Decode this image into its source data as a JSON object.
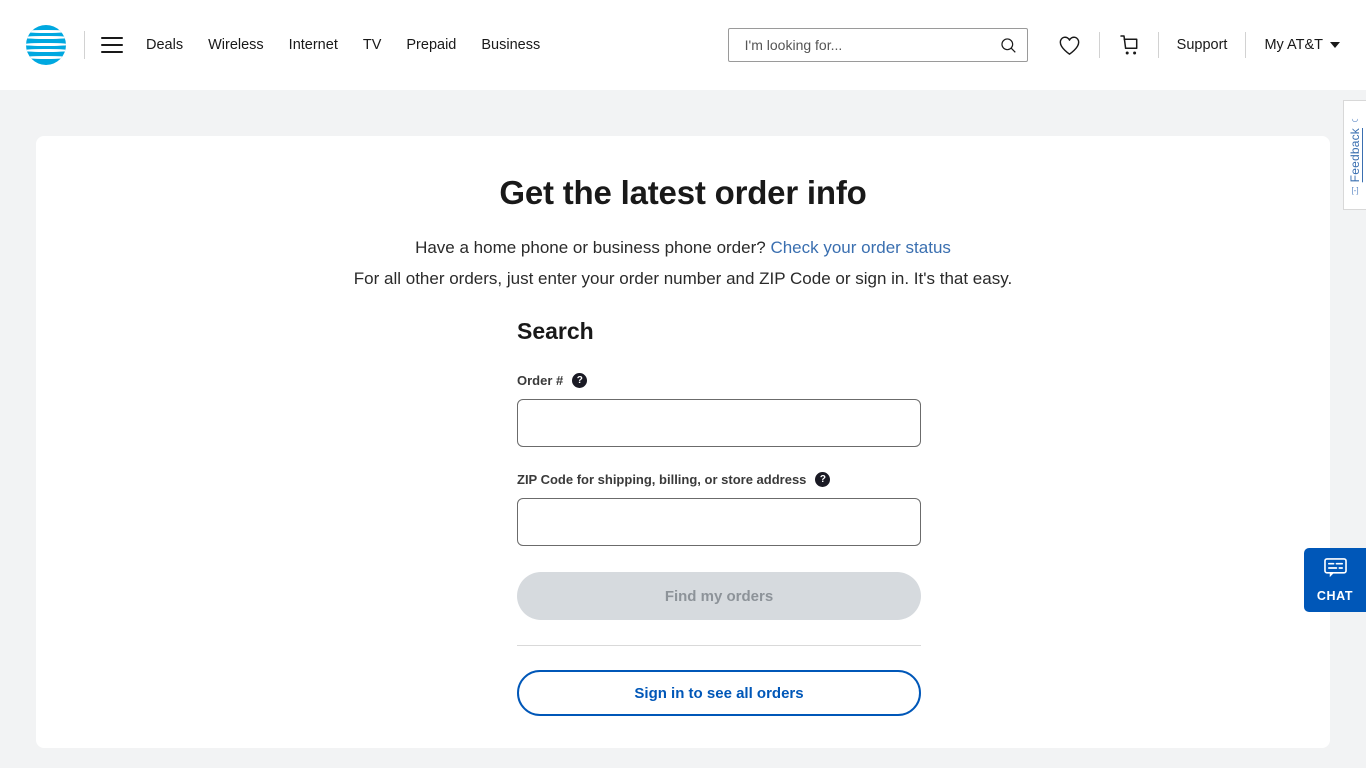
{
  "header": {
    "logo_alt": "AT&T globe logo",
    "menu_label": "Menu",
    "nav": [
      {
        "label": "Deals"
      },
      {
        "label": "Wireless"
      },
      {
        "label": "Internet"
      },
      {
        "label": "TV"
      },
      {
        "label": "Prepaid"
      },
      {
        "label": "Business"
      }
    ],
    "search": {
      "placeholder": "I'm looking for...",
      "value": "",
      "icon": "search-icon"
    },
    "wishlist_icon": "heart-icon",
    "cart_icon": "cart-icon",
    "support_label": "Support",
    "account_label": "My AT&T",
    "account_chevron": "chevron-down-icon"
  },
  "main": {
    "title": "Get the latest order info",
    "subtitle_prefix": "Have a home phone or business phone order? ",
    "subtitle_link": "Check your order status",
    "subtitle_secondary": "For all other orders, just enter your order number and ZIP Code or sign in. It's that easy."
  },
  "form": {
    "heading": "Search",
    "order_label": "Order #",
    "order_help_icon": "?",
    "order_value": "",
    "zip_label": "ZIP Code for shipping, billing, or store address",
    "zip_help_icon": "?",
    "zip_value": "",
    "submit_label": "Find my orders",
    "signin_label": "Sign in to see all orders"
  },
  "feedback": {
    "label": "Feedback",
    "top_icon": "resize-icon",
    "bottom_icon": "expand-icon"
  },
  "chat": {
    "label": "CHAT",
    "icon": "chat-bubble-icon"
  },
  "colors": {
    "brand_blue": "#0057b8",
    "logo_blue": "#00a8e0",
    "link_blue": "#3a6fb0",
    "page_bg": "#f2f3f4",
    "disabled_bg": "#d6dade",
    "disabled_text": "#8d9399"
  }
}
